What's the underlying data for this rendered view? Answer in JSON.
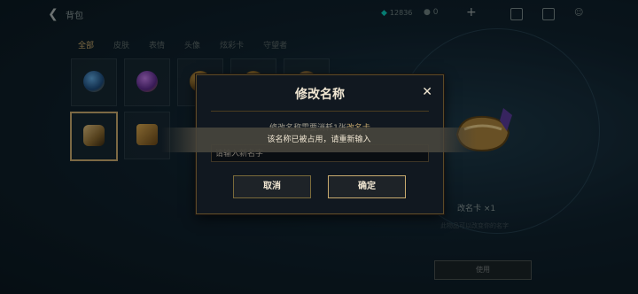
{
  "header": {
    "back_label": "背包",
    "currency_amount": "12836",
    "coin_amount": "0"
  },
  "tabs": [
    "全部",
    "皮肤",
    "表情",
    "头像",
    "炫彩卡",
    "守望者"
  ],
  "preview": {
    "item_name": "改名卡 ×1",
    "item_sub": "此物品可以改变你的名字",
    "use_button": "使用"
  },
  "dialog": {
    "title": "修改名称",
    "close_icon": "close-icon",
    "cost_prefix": "修改名称需要消耗1张",
    "cost_item": "改名卡",
    "input_placeholder": "请输入新名字",
    "cancel_label": "取消",
    "confirm_label": "确定"
  },
  "toast": {
    "message": "该名称已被占用，请重新输入"
  },
  "colors": {
    "gold": "#c8aa6e",
    "text_light": "#f0e6d2",
    "teal": "#0ac8b9"
  }
}
